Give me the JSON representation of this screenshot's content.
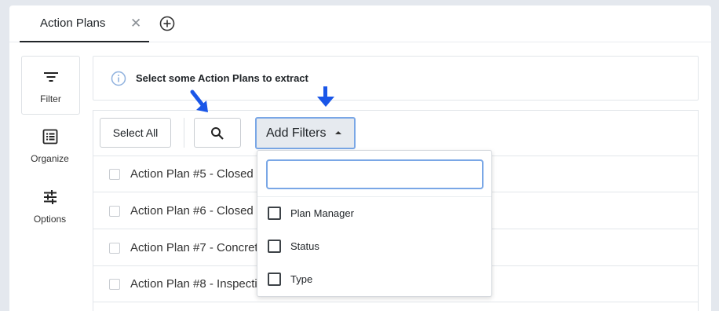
{
  "tabs": [
    {
      "label": "Action Plans",
      "close": "✕"
    }
  ],
  "rail": {
    "items": [
      {
        "label": "Filter",
        "icon": "filter-icon"
      },
      {
        "label": "Organize",
        "icon": "list-icon"
      },
      {
        "label": "Options",
        "icon": "sliders-icon"
      }
    ]
  },
  "info": {
    "icon": "info-icon",
    "text": "Select some Action Plans to extract"
  },
  "toolbar": {
    "select_all_label": "Select All",
    "search_icon": "search-icon",
    "add_filters_label": "Add Filters"
  },
  "rows": [
    {
      "label": "Action Plan #5 - Closed"
    },
    {
      "label": "Action Plan #6 - Closed"
    },
    {
      "label": "Action Plan #7 - Concrete"
    },
    {
      "label": "Action Plan #8 - Inspection"
    }
  ],
  "dropdown": {
    "search_value": "",
    "items": [
      {
        "label": "Plan Manager"
      },
      {
        "label": "Status"
      },
      {
        "label": "Type"
      }
    ]
  },
  "colors": {
    "accent_border": "#7aa7e6",
    "arrow": "#1a56e8",
    "background": "#e4e8ee"
  }
}
